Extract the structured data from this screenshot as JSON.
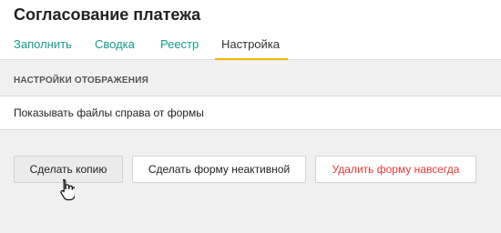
{
  "header": {
    "title": "Согласование платежа",
    "tabs": [
      {
        "label": "Заполнить"
      },
      {
        "label": "Сводка"
      },
      {
        "label": "Реестр"
      },
      {
        "label": "Настройка",
        "active": true
      }
    ]
  },
  "display_settings": {
    "section_title": "НАСТРОЙКИ ОТОБРАЖЕНИЯ",
    "option_label": "Показывать файлы справа от формы"
  },
  "actions": {
    "copy_label": "Сделать копию",
    "deactivate_label": "Сделать форму неактивной",
    "delete_label": "Удалить форму навсегда"
  },
  "colors": {
    "tab_link": "#1a9a8e",
    "tab_active_underline": "#f0b400",
    "delete_text": "#e53935"
  },
  "icons": {
    "cursor": "hand-pointer-icon"
  }
}
